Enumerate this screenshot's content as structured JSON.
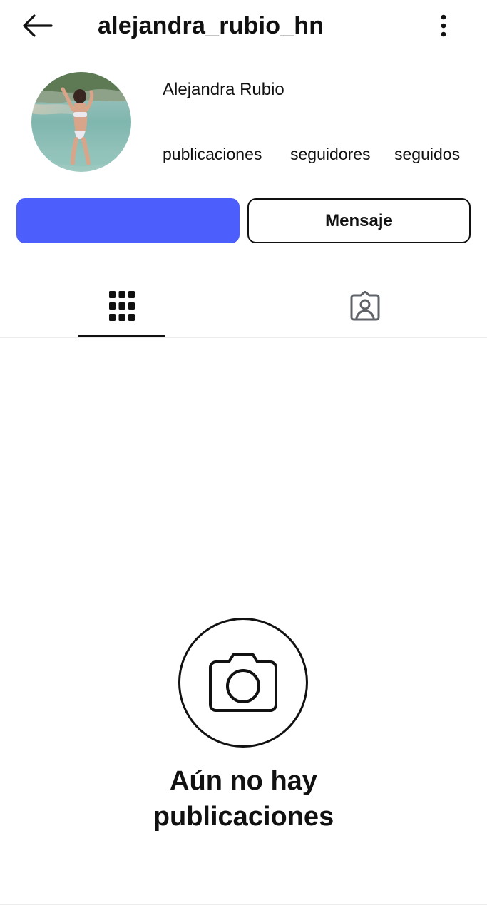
{
  "header": {
    "username": "alejandra_rubio_hn",
    "back_icon": "arrow-left-icon",
    "more_icon": "more-vertical-icon"
  },
  "profile": {
    "display_name": "Alejandra Rubio",
    "stats": {
      "posts_label": "publicaciones",
      "followers_label": "seguidores",
      "following_label": "seguidos"
    }
  },
  "actions": {
    "follow_label": "",
    "message_label": "Mensaje",
    "follow_color": "#4c5ffc"
  },
  "tabs": [
    {
      "icon": "grid-icon",
      "active": true
    },
    {
      "icon": "tagged-person-icon",
      "active": false
    }
  ],
  "empty_state": {
    "icon": "camera-icon",
    "line1": "Aún no hay",
    "line2": "publicaciones"
  }
}
